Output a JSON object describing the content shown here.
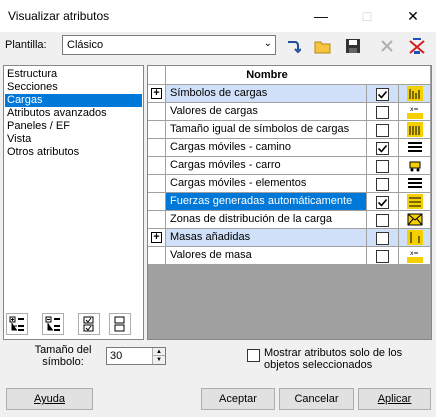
{
  "window": {
    "title": "Visualizar atributos"
  },
  "plantilla": {
    "label": "Plantilla:",
    "value": "Clásico"
  },
  "left_list": {
    "items": [
      "Estructura",
      "Secciones",
      "Cargas",
      "Atributos avanzados",
      "Paneles / EF",
      "Vista",
      "Otros atributos"
    ],
    "selected_index": 2
  },
  "grid": {
    "header": "Nombre",
    "rows": [
      {
        "expandable": true,
        "label": "Símbolos de cargas",
        "checked": true,
        "icon": "load-bars-icon",
        "highlight": true
      },
      {
        "expandable": false,
        "label": "Valores de cargas",
        "checked": false,
        "icon": "load-values-icon"
      },
      {
        "expandable": false,
        "label": "Tamaño igual de símbolos de cargas",
        "checked": false,
        "icon": "equal-size-icon"
      },
      {
        "expandable": false,
        "label": "Cargas móviles - camino",
        "checked": true,
        "icon": "path-lines-icon"
      },
      {
        "expandable": false,
        "label": "Cargas móviles - carro",
        "checked": false,
        "icon": "cart-icon"
      },
      {
        "expandable": false,
        "label": "Cargas móviles - elementos",
        "checked": false,
        "icon": "elements-lines-icon"
      },
      {
        "expandable": false,
        "label": "Fuerzas generadas automáticamente",
        "checked": true,
        "icon": "auto-forces-icon",
        "selected": true
      },
      {
        "expandable": false,
        "label": "Zonas de distribución de la carga",
        "checked": false,
        "icon": "envelope-icon"
      },
      {
        "expandable": true,
        "label": "Masas añadidas",
        "checked": false,
        "icon": "mass-icon",
        "highlight": true
      },
      {
        "expandable": false,
        "label": "Valores de masa",
        "checked": false,
        "icon": "mass-values-icon"
      }
    ]
  },
  "symbol_size": {
    "label_line1": "Tamaño del",
    "label_line2": "símbolo:",
    "value": "30"
  },
  "show_selected": {
    "label_line1": "Mostrar atributos solo de los",
    "label_line2": "objetos seleccionados",
    "checked": false
  },
  "buttons": {
    "help": "Ayuda",
    "accept": "Aceptar",
    "cancel": "Cancelar",
    "apply": "Aplicar"
  },
  "colors": {
    "selection": "#0078d7",
    "highlight": "#cfe0f8",
    "icon_yellow": "#e8c800"
  }
}
